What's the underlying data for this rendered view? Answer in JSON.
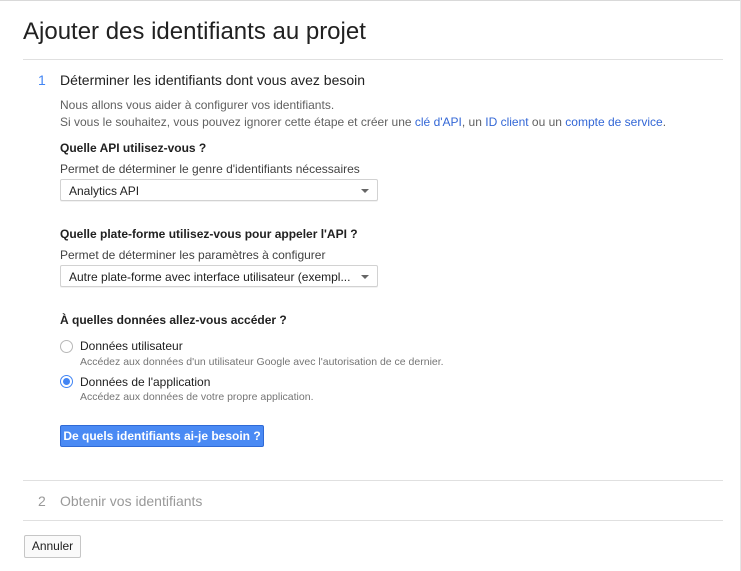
{
  "page": {
    "title": "Ajouter des identifiants au projet"
  },
  "steps": [
    {
      "number": "1",
      "title": "Déterminer les identifiants dont vous avez besoin",
      "active": true
    },
    {
      "number": "2",
      "title": "Obtenir vos identifiants",
      "active": false
    }
  ],
  "intro": {
    "line1": "Nous allons vous aider à configurer vos identifiants.",
    "line2_prefix": "Si vous le souhaitez, vous pouvez ignorer cette étape et créer une ",
    "link_api_key": "clé d'API",
    "sep1": ", un ",
    "link_client_id": "ID client",
    "sep2": " ou un ",
    "link_service_account": "compte de service",
    "line2_suffix": "."
  },
  "api_question": {
    "title": "Quelle API utilisez-vous ?",
    "help": "Permet de déterminer le genre d'identifiants nécessaires",
    "selected": "Analytics API"
  },
  "platform_question": {
    "title": "Quelle plate-forme utilisez-vous pour appeler l'API ?",
    "help": "Permet de déterminer les paramètres à configurer",
    "selected": "Autre plate-forme avec interface utilisateur (exempl..."
  },
  "data_question": {
    "title": "À quelles données allez-vous accéder ?",
    "options": [
      {
        "label": "Données utilisateur",
        "description": "Accédez aux données d'un utilisateur Google avec l'autorisation de ce dernier.",
        "checked": false
      },
      {
        "label": "Données de l'application",
        "description": "Accédez aux données de votre propre application.",
        "checked": true
      }
    ]
  },
  "buttons": {
    "which_credentials": "De quels identifiants ai-je besoin ?",
    "cancel": "Annuler"
  },
  "colors": {
    "accent": "#4285f4",
    "link": "#3367d6",
    "muted": "#999999"
  }
}
